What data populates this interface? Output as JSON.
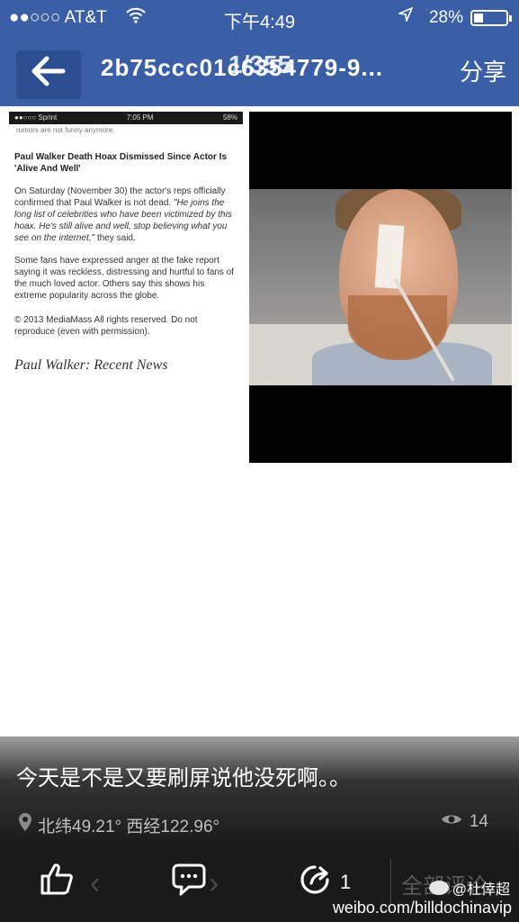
{
  "status_bar": {
    "carrier": "●●○○○ AT&T",
    "time": "下午4:49",
    "battery_pct": "28%",
    "battery_level": 0.28
  },
  "top_bar": {
    "back_icon": "arrow-left-icon",
    "title": "2b75ccc01c6354779-9...",
    "counter": "1/355",
    "share_label": "分享"
  },
  "article": {
    "mini_status": {
      "carrier": "●●○○○ Sprint",
      "time": "7:05 PM",
      "battery": "58%"
    },
    "cut_text": "rumors are not funny anymore.",
    "headline": "Paul Walker Death Hoax Dismissed Since Actor Is 'Alive And Well'",
    "para1_start": "On Saturday (November 30) the actor's reps officially confirmed that Paul Walker is not dead. ",
    "para1_quote": "\"He joins the long list of celebrities who have been victimized by this hoax. He's still alive and well, stop believing what you see on the internet,\"",
    "para1_end": " they said.",
    "para2": "Some fans have expressed anger at the fake report saying it was reckless, distressing and hurtful to fans of the much loved actor. Others say this shows his extreme popularity across the globe.",
    "footer": "© 2013 MediaMass All rights reserved. Do not reproduce (even with permission).",
    "next_heading": "Paul Walker: Recent News"
  },
  "caption": {
    "text": "今天是不是又要刷屏说他没死啊。。",
    "location": "北纬49.21° 西经122.96°",
    "views": "14"
  },
  "actions": {
    "repost_count": "1",
    "all_comments": "全部评论"
  },
  "watermark": {
    "handle": "@杜倖超",
    "url": "weibo.com/billdochinavip"
  }
}
